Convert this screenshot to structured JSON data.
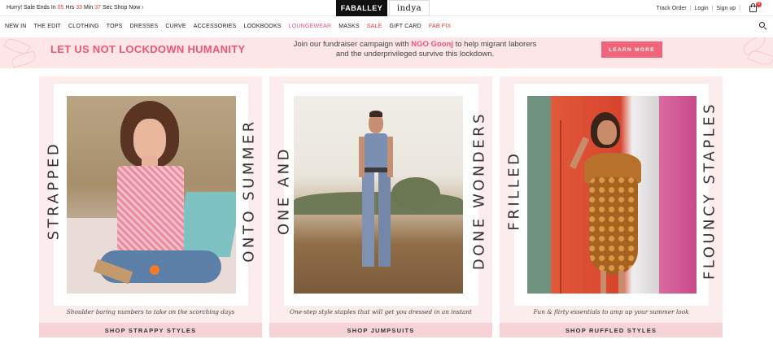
{
  "topbar": {
    "sale_prefix": "Hurry! Sale Ends In",
    "hrs_value": "05",
    "hrs_label": "Hrs",
    "min_value": "33",
    "min_label": "Min",
    "sec_value": "37",
    "sec_label": "Sec",
    "shop_now": "Shop Now ›",
    "brand_primary": "FABALLEY",
    "brand_secondary": "indya",
    "links": [
      "Track Order",
      "Login",
      "Sign up"
    ],
    "cart_count": "0"
  },
  "nav": {
    "items": [
      {
        "label": "NEW IN"
      },
      {
        "label": "THE EDIT"
      },
      {
        "label": "CLOTHING"
      },
      {
        "label": "TOPS"
      },
      {
        "label": "DRESSES"
      },
      {
        "label": "CURVE"
      },
      {
        "label": "ACCESSORIES"
      },
      {
        "label": "LOOKBOOKS"
      },
      {
        "label": "LOUNGEWEAR"
      },
      {
        "label": "MASKS"
      },
      {
        "label": "SALE"
      },
      {
        "label": "GIFT CARD"
      },
      {
        "label": "FAB FIX"
      }
    ]
  },
  "banner": {
    "title": "LET US NOT LOCKDOWN HUMANITY",
    "msg_pre": "Join our fundraiser campaign with",
    "msg_ngo": "NGO Goonj",
    "msg_post": "to help migrant laborers",
    "msg_line2": "and the underprivileged survive this lockdown.",
    "cta": "LEARN MORE"
  },
  "cards": [
    {
      "left_text": "STRAPPED",
      "right_text": "ONTO SUMMER",
      "caption": "Shoulder baring numbers to take on the scorching days",
      "button": "SHOP STRAPPY STYLES"
    },
    {
      "left_text": "ONE AND",
      "right_text": "DONE WONDERS",
      "caption": "One-step style staples that will get you dressed in an instant",
      "button": "SHOP JUMPSUITS"
    },
    {
      "left_text": "FRILLED",
      "right_text": "FLOUNCY STAPLES",
      "caption": "Fun & flirty essentials to amp up your summer look",
      "button": "SHOP RUFFLED STYLES"
    }
  ],
  "colors": {
    "accent_pink": "#ef5577",
    "card_bg": "#fdecee",
    "button_bg": "#f6d3d7",
    "banner_bg": "#fde6e8"
  }
}
